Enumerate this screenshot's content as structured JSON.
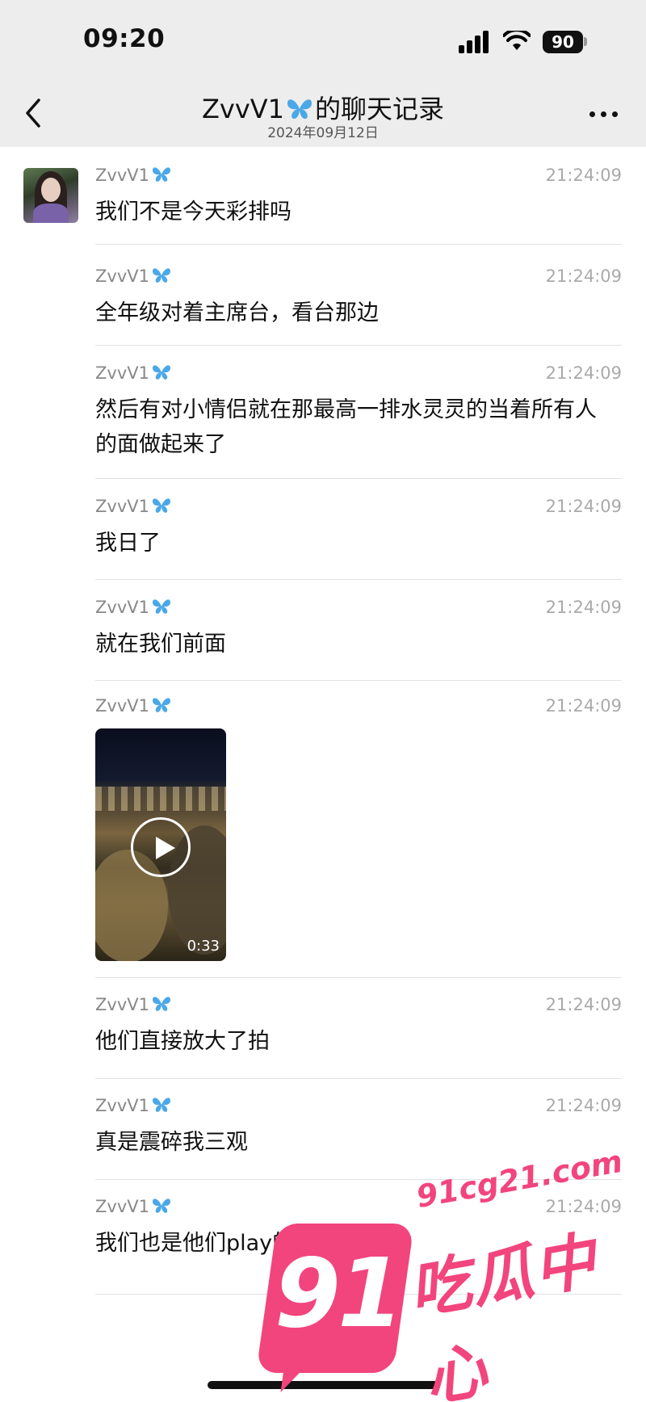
{
  "status_bar": {
    "time": "09:20",
    "battery": "90",
    "signal_icon": "cellular-signal-icon",
    "wifi_icon": "wifi-icon"
  },
  "nav": {
    "title_prefix": "ZvvV1",
    "title_suffix": "的聊天记录",
    "date": "2024年09月12日",
    "back_icon": "chevron-left-icon",
    "more_icon": "more-dots-icon"
  },
  "colors": {
    "butterfly": "#4aa8e8",
    "watermark": "#f2457d",
    "nav_bg": "#ededed"
  },
  "messages": [
    {
      "sender": "ZvvV1",
      "time": "21:24:09",
      "text": "我们不是今天彩排吗"
    },
    {
      "sender": "ZvvV1",
      "time": "21:24:09",
      "text": "全年级对着主席台，看台那边"
    },
    {
      "sender": "ZvvV1",
      "time": "21:24:09",
      "text": "然后有对小情侣就在那最高一排水灵灵的当着所有人的面做起来了"
    },
    {
      "sender": "ZvvV1",
      "time": "21:24:09",
      "text": "我日了"
    },
    {
      "sender": "ZvvV1",
      "time": "21:24:09",
      "text": "就在我们前面"
    },
    {
      "sender": "ZvvV1",
      "time": "21:24:09",
      "video_duration": "0:33"
    },
    {
      "sender": "ZvvV1",
      "time": "21:24:09",
      "text": "他们直接放大了拍"
    },
    {
      "sender": "ZvvV1",
      "time": "21:24:09",
      "text": "真是震碎我三观"
    },
    {
      "sender": "ZvvV1",
      "time": "21:24:09",
      "text": "我们也是他们play的一环吗"
    }
  ],
  "watermark": {
    "number": "91",
    "url": "91cg21.com",
    "name": "吃瓜中心"
  }
}
